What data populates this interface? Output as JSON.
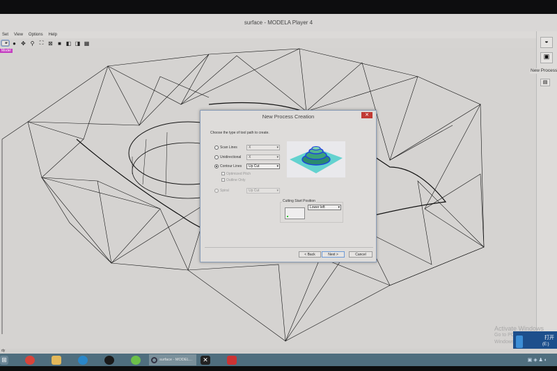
{
  "window": {
    "title": "surface - MODELA Player 4"
  },
  "menu": [
    "Set",
    "View",
    "Options",
    "Help"
  ],
  "viewport": {
    "tag": "Model"
  },
  "status": {
    "text": "dy"
  },
  "right_panel": {
    "label": "New Process"
  },
  "dialog": {
    "title": "New Process Creation",
    "close_label": "✕",
    "prompt": "Choose the type of tool path to create.",
    "options": [
      {
        "label": "Scan Lines",
        "value": "X",
        "selected": false,
        "enabled": true
      },
      {
        "label": "Unidirectional",
        "value": "X",
        "selected": false,
        "enabled": true
      },
      {
        "label": "Contour Lines",
        "value": "Up Cut",
        "selected": true,
        "enabled": true
      },
      {
        "label": "Spiral",
        "value": "Up Cut",
        "selected": false,
        "enabled": false
      }
    ],
    "checkboxes": [
      {
        "label": "Optimized Pitch",
        "checked": false
      },
      {
        "label": "Outline Only",
        "checked": false
      }
    ],
    "cutting_start": {
      "label": "Cutting Start Position",
      "value": "Lower left"
    },
    "buttons": {
      "back": "< Back",
      "next": "Next >",
      "cancel": "Cancel"
    }
  },
  "watermark": {
    "line1": "Activate Windows",
    "line2": "Go to PC settings to activate Windows."
  },
  "toast": {
    "title": "打开",
    "sub": "(E:)"
  },
  "taskbar": {
    "active_app": "surface - MODEL..."
  }
}
